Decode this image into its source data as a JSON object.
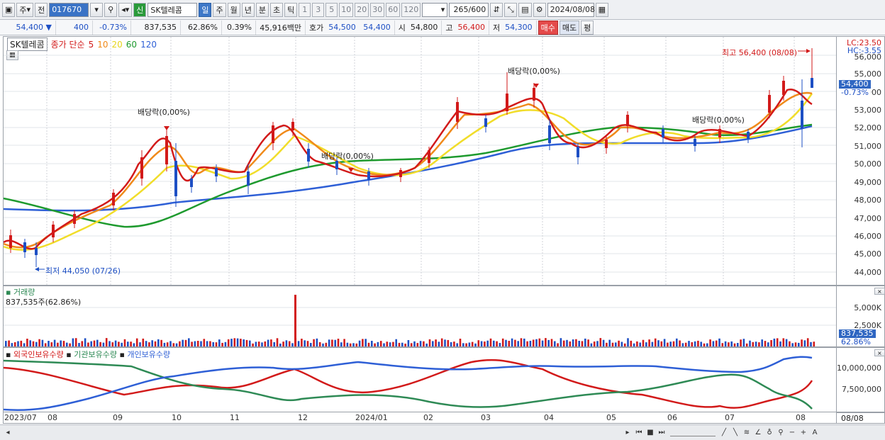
{
  "toolbar": {
    "period_type": "주",
    "prev_label": "전",
    "code": "017670",
    "stock_name": "SK텔레콤",
    "new_label": "신",
    "periods": [
      "일",
      "주",
      "월",
      "년",
      "분",
      "초",
      "틱"
    ],
    "intervals": [
      "1",
      "3",
      "5",
      "10",
      "20",
      "30",
      "60",
      "120"
    ],
    "count": "265",
    "count_total": "/600",
    "date": "2024/08/08"
  },
  "quote": {
    "price": "54,400",
    "down_marker": "▼",
    "change": "400",
    "change_pct": "-0.73%",
    "volume": "837,535",
    "vol_ratio": "62.86%",
    "turnover_pct": "0.39%",
    "amount": "45,916백만",
    "ask_label": "호가",
    "ask1": "54,500",
    "ask2": "54,400",
    "open_label": "시",
    "open": "54,800",
    "high_label": "고",
    "high": "56,400",
    "low_label": "저",
    "low": "54,300",
    "buy_label": "매수",
    "sell_label": "매도",
    "avg_label": "평"
  },
  "price_pane": {
    "name": "SK텔레콤",
    "ma_label": "종가 단순",
    "ma_periods": [
      {
        "p": "5",
        "color": "#d21a1a"
      },
      {
        "p": "10",
        "color": "#f08a1a"
      },
      {
        "p": "20",
        "color": "#e6d51a"
      },
      {
        "p": "60",
        "color": "#1e9a2e"
      },
      {
        "p": "120",
        "color": "#2e5fd6"
      }
    ],
    "lc": "LC:23.50",
    "hc": "HC:-3.55",
    "y_ticks": [
      "56,000",
      "55,000",
      "54,000",
      "53,000",
      "52,000",
      "51,000",
      "50,000",
      "49,000",
      "48,000",
      "47,000",
      "46,000",
      "45,000",
      "44,000"
    ],
    "price_box": "54,400",
    "pct_box": "-0.73%",
    "high_note": "최고 56,400 (08/08)",
    "low_note": "최저 44,050 (07/26)",
    "dividends": [
      "배당락(0,00%)",
      "배당락(0,00%)",
      "배당락(0,00%)",
      "배당락(0,00%)"
    ]
  },
  "volume_pane": {
    "title": "거래량",
    "value": "837,535주(62.86%)",
    "y_ticks": [
      "5,000K",
      "2,500K"
    ],
    "vol_box": "837,535",
    "pct_box": "62.86%"
  },
  "holdings_pane": {
    "series": [
      {
        "name": "외국인보유수량",
        "color": "#d21a1a"
      },
      {
        "name": "기관보유수량",
        "color": "#2e8a55"
      },
      {
        "name": "개인보유수량",
        "color": "#2e5fd6"
      }
    ],
    "y_ticks": [
      "10,000,000",
      "7,500,000"
    ]
  },
  "x_axis": {
    "labels": [
      "2023/07",
      "08",
      "09",
      "10",
      "11",
      "12",
      "2024/01",
      "02",
      "03",
      "04",
      "05",
      "06",
      "07",
      "08"
    ],
    "end_label": "08/08"
  },
  "colors": {
    "up": "#d21a1a",
    "down": "#1d4fc4",
    "accent": "#3a73c6"
  }
}
